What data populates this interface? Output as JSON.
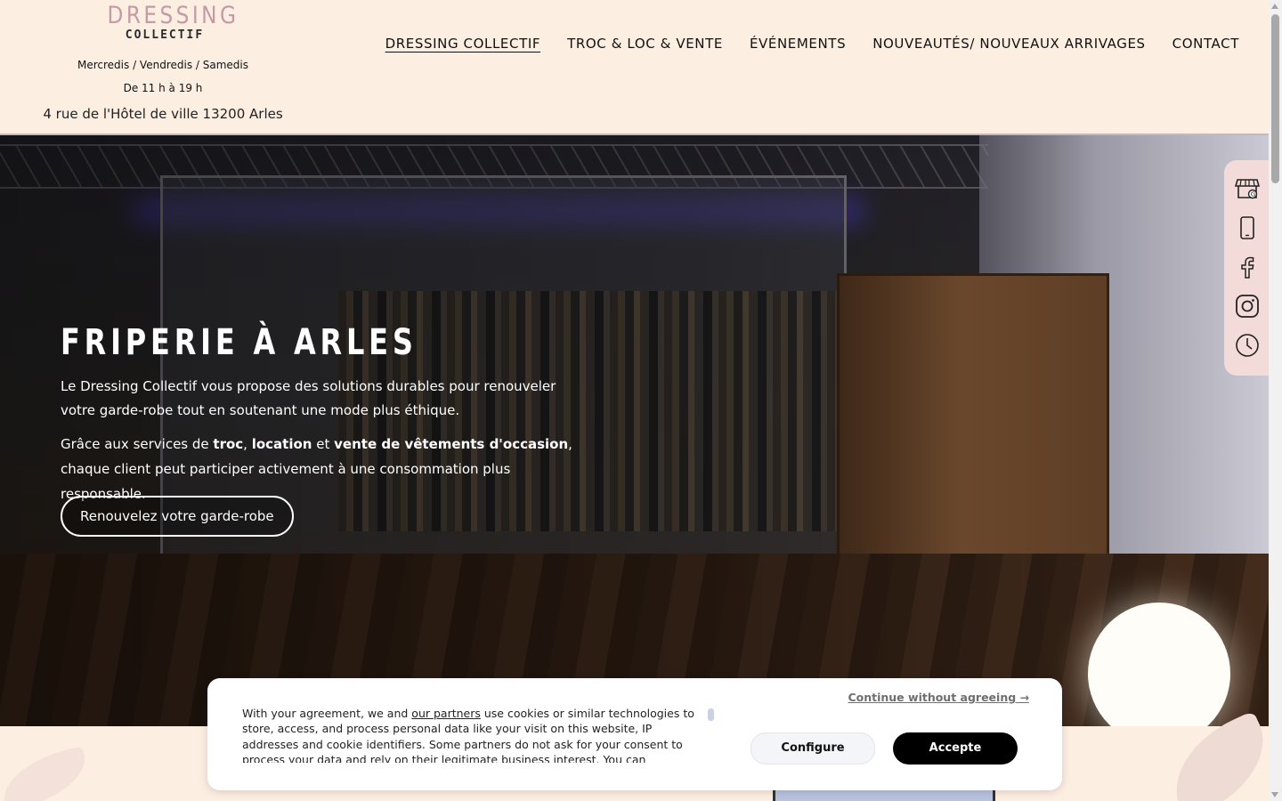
{
  "header": {
    "logo_main": "DRESSING",
    "logo_sub": "COLLECTIF",
    "hours_days": "Mercredis / Vendredis / Samedis",
    "hours_time": "De 11 h à 19 h",
    "address": "4 rue de l'Hôtel de ville 13200 Arles"
  },
  "nav": {
    "items": [
      {
        "label": "DRESSING COLLECTIF",
        "active": true
      },
      {
        "label": "TROC & LOC & VENTE",
        "active": false
      },
      {
        "label": "ÉVÉNEMENTS",
        "active": false
      },
      {
        "label": "NOUVEAUTÉS/ NOUVEAUX ARRIVAGES",
        "active": false
      },
      {
        "label": "CONTACT",
        "active": false
      }
    ]
  },
  "hero": {
    "title": "FRIPERIE À ARLES",
    "paragraph1": "Le Dressing Collectif vous propose des solutions durables pour renouveler votre garde-robe tout en soutenant une mode plus éthique.",
    "paragraph2": {
      "prefix": "Grâce aux services de ",
      "bold1": "troc",
      "sep1": ", ",
      "bold2": "location",
      "sep2": " et ",
      "bold3": "vente de vêtements d'occasion",
      "suffix": ", chaque client peut participer activement à une consommation plus responsable."
    },
    "cta_label": "Renouvelez votre garde-robe"
  },
  "side_icons": [
    "storefront-google-icon",
    "phone-icon",
    "facebook-icon",
    "instagram-icon",
    "clock-icon"
  ],
  "cookie_banner": {
    "text_before_link": "With your agreement, we and ",
    "link_text": "our partners",
    "text_after_link": " use cookies or similar technologies to store, access, and process personal data like your visit on this website, IP addresses and cookie identifiers. Some partners do not ask for your consent to process your data and rely on their legitimate business interest. You can",
    "continue_label": "Continue without agreeing →",
    "configure_label": "Configure",
    "accept_label": "Accepte"
  },
  "colors": {
    "background": "#fdeee2",
    "logo_pink": "#c39aa5",
    "side_bar": "#f3dbd9",
    "accept_button": "#000000"
  }
}
